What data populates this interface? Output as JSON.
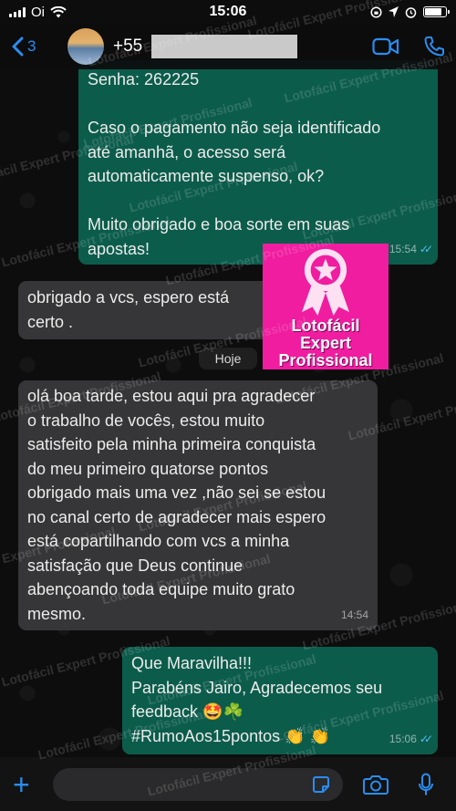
{
  "status_bar": {
    "carrier": "Oi",
    "time": "15:06"
  },
  "header": {
    "back_count": "3",
    "contact_prefix": "+55"
  },
  "messages": {
    "m1": {
      "lines": [
        "Senha: 262225",
        "",
        "Caso o pagamento não seja identificado",
        "até amanhã, o acesso será",
        "automaticamente suspenso, ok?",
        "",
        "Muito obrigado e boa sorte em suas",
        "apostas!"
      ],
      "time": "15:54"
    },
    "m2": {
      "lines": [
        "obrigado a vcs, espero está",
        "certo ."
      ]
    },
    "date_separator": "Hoje",
    "m3": {
      "lines": [
        "olá boa tarde, estou aqui pra agradecer",
        "o  trabalho de vocês, estou muito",
        "satisfeito pela minha primeira conquista",
        "do meu primeiro quatorse pontos",
        "obrigado mais uma vez ,não sei se estou",
        "no canal certo de agradecer mais espero",
        "está copartilhando com vcs a minha",
        "satisfação que Deus continue",
        "abençoando toda equipe muito grato",
        "mesmo."
      ],
      "time": "14:54"
    },
    "m4": {
      "lines": [
        "Que Maravilha!!!",
        "Parabéns Jairo, Agradecemos seu",
        "feedback 🤩☘️",
        "#RumoAos15pontos 👏 👏"
      ],
      "time": "15:06"
    }
  },
  "logo": {
    "line1": "Lotofácil",
    "line2": "Expert",
    "line3": "Profissional"
  },
  "watermark_text": "Lotofácil Expert Profissional",
  "colors": {
    "accent": "#2a8df2",
    "outgoing_bubble": "#0c5c4c",
    "incoming_bubble": "#363638",
    "logo_bg": "#f01da0"
  }
}
